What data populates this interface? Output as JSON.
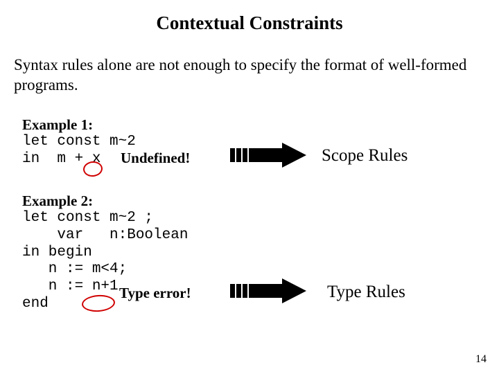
{
  "title": "Contextual Constraints",
  "intro": "Syntax rules alone are not enough to specify the format of well-formed programs.",
  "example1": {
    "label": "Example 1:",
    "code": "let const m~2\nin  m + x",
    "annotation": "Undefined!",
    "rule": "Scope Rules"
  },
  "example2": {
    "label": "Example 2:",
    "code": "let const m~2 ;\n    var   n:Boolean\nin begin\n   n := m<4;\n   n := n+1\nend",
    "annotation": "Type error!",
    "rule": "Type Rules"
  },
  "page_number": "14"
}
